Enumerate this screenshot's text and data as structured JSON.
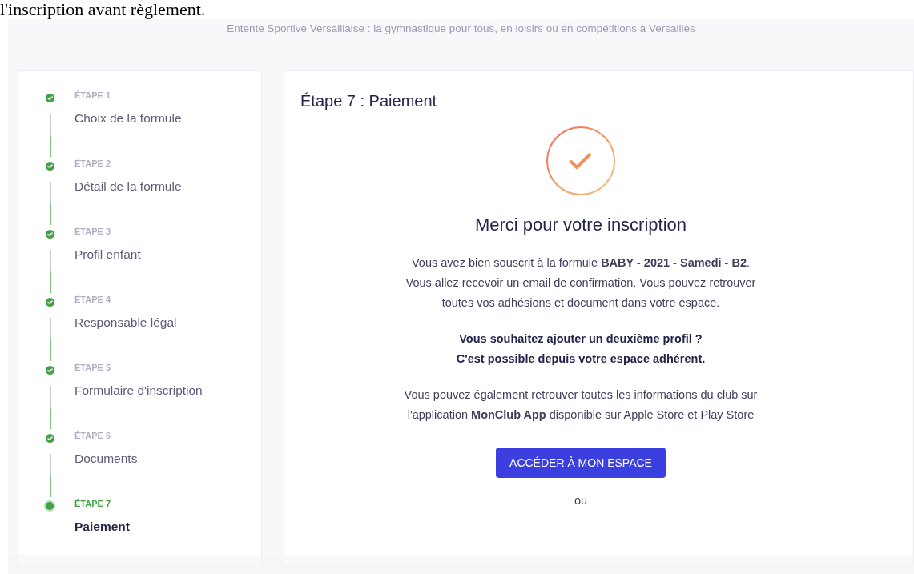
{
  "top_text": "l'inscription avant règlement.",
  "tagline": "Entente Sportive Versaillaise : la gymnastique pour tous, en loisirs ou en compétitions à Versailles",
  "steps": [
    {
      "label": "ÉTAPE 1",
      "title": "Choix de la formule",
      "completed": true,
      "selected": false
    },
    {
      "label": "ÉTAPE 2",
      "title": "Détail de la formule",
      "completed": true,
      "selected": false
    },
    {
      "label": "ÉTAPE 3",
      "title": "Profil enfant",
      "completed": true,
      "selected": false
    },
    {
      "label": "ÉTAPE 4",
      "title": "Responsable légal",
      "completed": true,
      "selected": false
    },
    {
      "label": "ÉTAPE 5",
      "title": "Formulaire d'inscription",
      "completed": true,
      "selected": false
    },
    {
      "label": "ÉTAPE 6",
      "title": "Documents",
      "completed": true,
      "selected": false
    },
    {
      "label": "ÉTAPE 7",
      "title": "Paiement",
      "completed": false,
      "selected": true
    }
  ],
  "main": {
    "title": "Étape 7 : Paiement",
    "heading": "Merci pour votre inscription",
    "paragraphs": [
      {
        "lines": [
          "Vous avez bien souscrit à la formule **BABY - 2021 - Samedi - B2**.",
          "Vous allez recevoir un email de confirmation. Vous pouvez retrouver",
          "toutes vos adhésions et document dans votre espace."
        ],
        "bold": false
      },
      {
        "lines": [
          "Vous souhaitez ajouter un deuxième profil ?",
          "C'est possible depuis votre espace adhérent."
        ],
        "bold": true
      },
      {
        "lines": [
          "Vous pouvez également retrouver toutes les informations du club sur",
          "l'application **MonClub App** disponible sur Apple Store et Play Store"
        ],
        "bold": false
      }
    ],
    "button": "ACCÉDER À MON ESPACE",
    "or": "ou"
  }
}
